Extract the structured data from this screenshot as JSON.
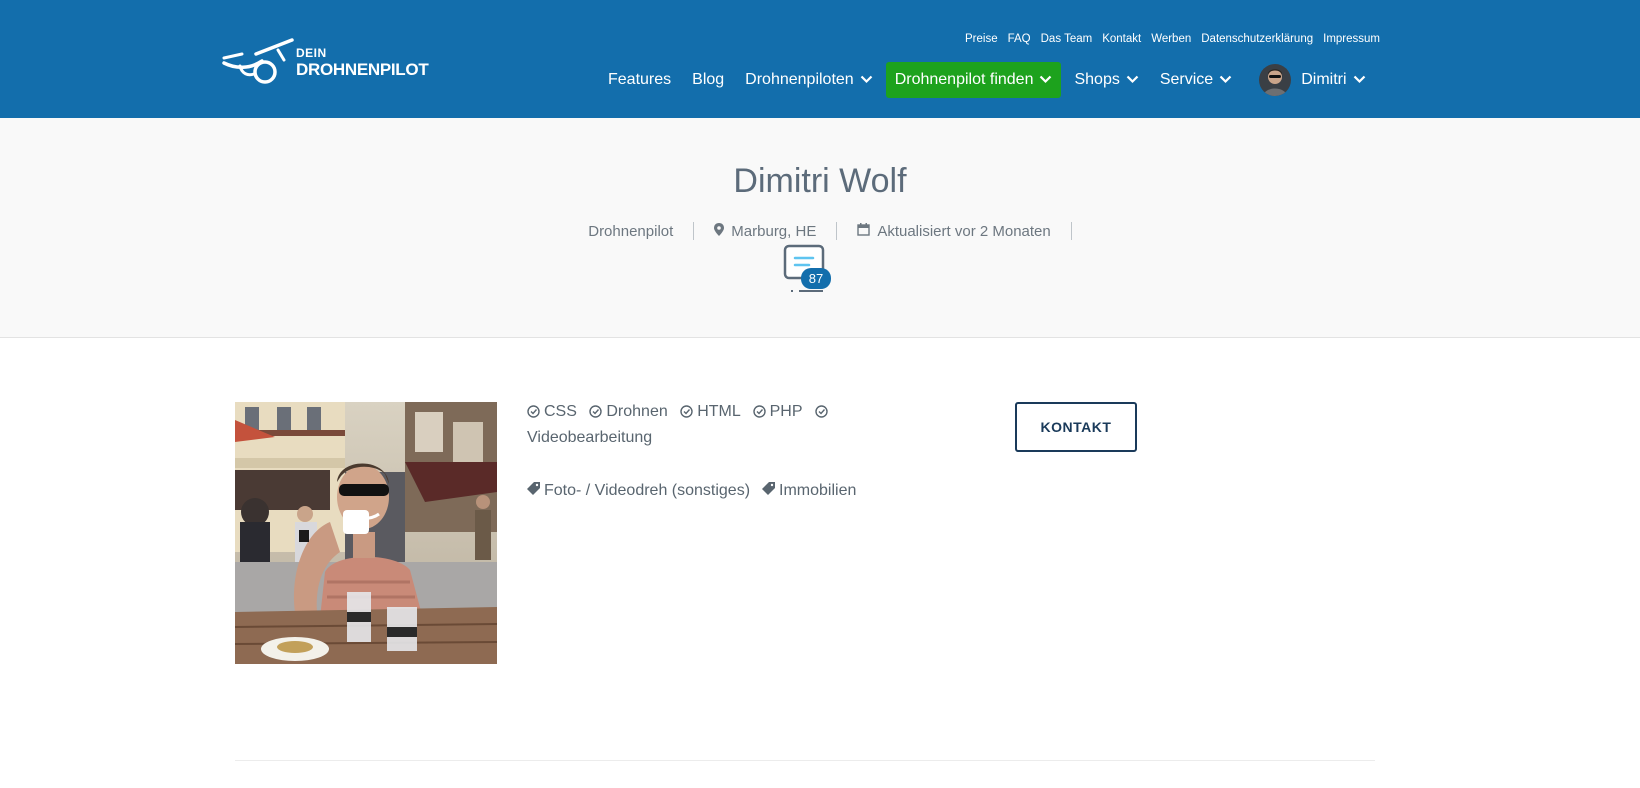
{
  "header": {
    "logo": {
      "small": "DEIN",
      "big": "DROHNENPILOT"
    },
    "top_links": [
      "Preise",
      "FAQ",
      "Das Team",
      "Kontakt",
      "Werben",
      "Datenschutzerklärung",
      "Impressum"
    ],
    "nav": [
      {
        "label": "Features",
        "dropdown": false
      },
      {
        "label": "Blog",
        "dropdown": false
      },
      {
        "label": "Drohnenpiloten",
        "dropdown": true
      },
      {
        "label": "Drohnenpilot finden",
        "dropdown": true,
        "highlight": true
      },
      {
        "label": "Shops",
        "dropdown": true
      },
      {
        "label": "Service",
        "dropdown": true
      }
    ],
    "user": {
      "name": "Dimitri"
    }
  },
  "profile": {
    "name": "Dimitri Wolf",
    "role": "Drohnenpilot",
    "location": "Marburg, HE",
    "updated": "Aktualisiert vor 2 Monaten",
    "messages_count": "87",
    "skills": [
      "CSS",
      "Drohnen",
      "HTML",
      "PHP",
      "Videobearbeitung"
    ],
    "categories": [
      "Foto- / Videodreh (sonstiges)",
      "Immobilien"
    ],
    "contact_label": "KONTAKT"
  },
  "colors": {
    "header_bg": "#136eac",
    "highlight_bg": "#1da21d",
    "hero_bg": "#f9f9f9",
    "text": "#59656f",
    "button_border": "#1a3a5a"
  }
}
